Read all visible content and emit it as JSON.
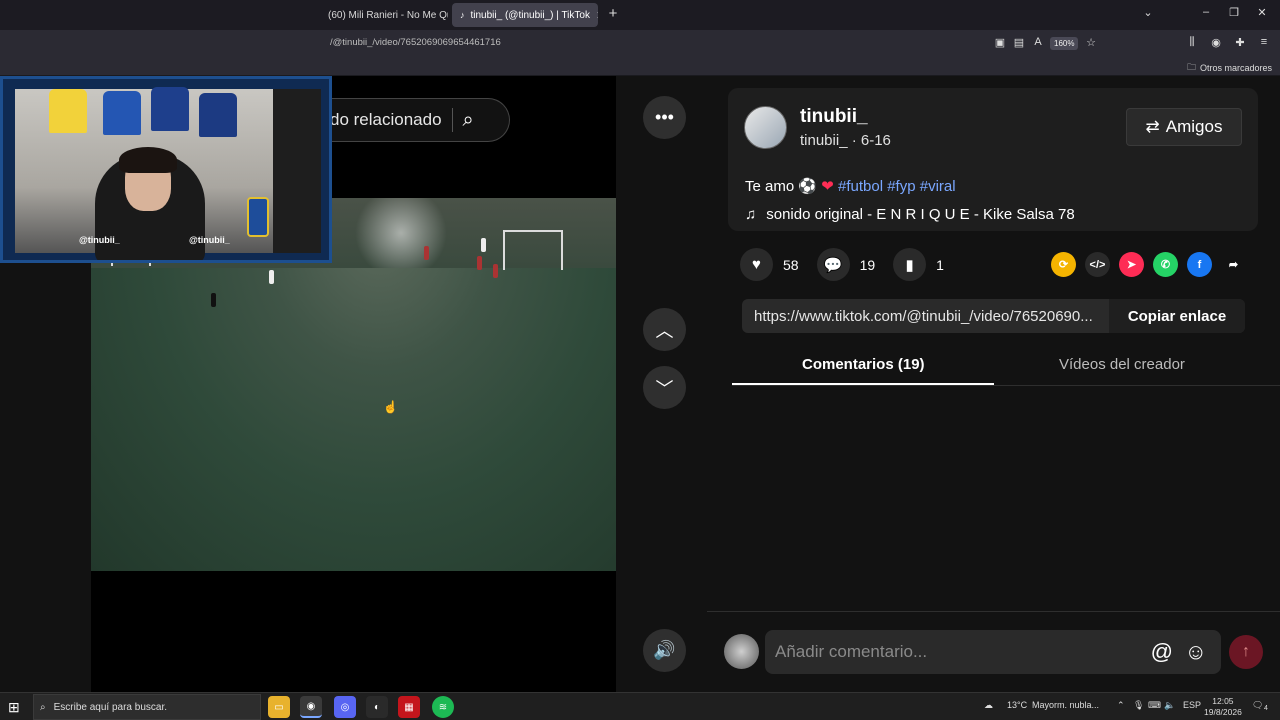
{
  "browser": {
    "tabs": [
      {
        "title": "(60) Mili Ranieri - No Me Qu",
        "active": false
      },
      {
        "title": "tinubii_ (@tinubii_) | TikTok",
        "active": true
      }
    ],
    "new_tab": "+",
    "url": "/@tinubii_/video/7652069069654461716",
    "zoom": "160%",
    "bookmarks_label": "Otros marcadores"
  },
  "search": {
    "text": "do relacionado"
  },
  "webcam": {
    "handle_left": "@tinubii_",
    "handle_right": "@tinubii_"
  },
  "post": {
    "username": "tinubii_",
    "subline": "tinubii_ · 6-16",
    "friends_button": "Amigos",
    "description": "Te amo",
    "hashtags": [
      "#futbol",
      "#fyp",
      "#viral"
    ],
    "music": "sonido original - E N R I Q U E - Kike Salsa 78",
    "likes": "58",
    "comments": "19",
    "saves": "1",
    "link": "https://www.tiktok.com/@tinubii_/video/76520690...",
    "copy_label": "Copiar enlace",
    "tab_comments": "Comentarios (19)",
    "tab_videos": "Vídeos del creador",
    "comment_placeholder": "Añadir comentario..."
  },
  "taskbar": {
    "search_placeholder": "Escribe aquí para buscar.",
    "weather_temp": "13°C",
    "weather_desc": "Mayorm. nubla...",
    "lang": "ESP",
    "time": "12:05",
    "date": "19/8/2026",
    "notif_count": "4"
  },
  "colors": {
    "accent": "#fe2c55",
    "hashtag": "#7aa7ff",
    "panel": "#121212"
  }
}
